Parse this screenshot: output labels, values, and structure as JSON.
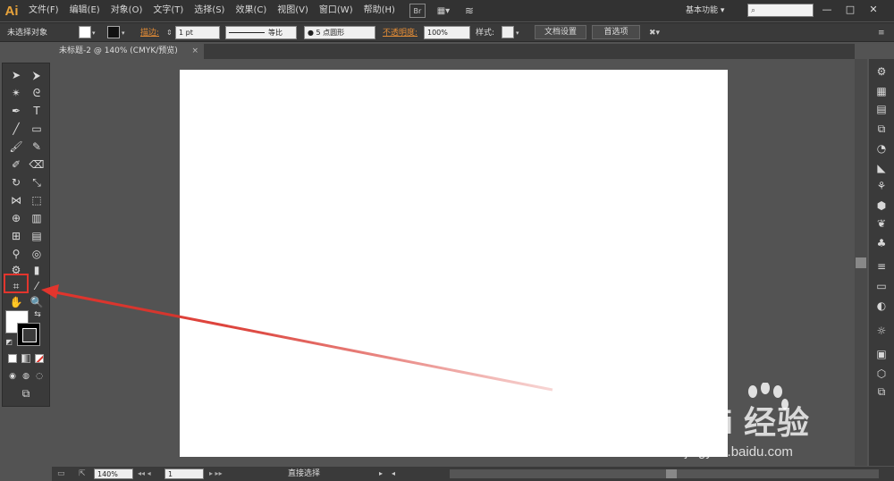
{
  "app": {
    "logo": "Ai",
    "workspace": "基本功能 ▾"
  },
  "menu": [
    "文件(F)",
    "编辑(E)",
    "对象(O)",
    "文字(T)",
    "选择(S)",
    "效果(C)",
    "视图(V)",
    "窗口(W)",
    "帮助(H)"
  ],
  "menu_icons": {
    "bridge": "Br",
    "layout": "▦▾",
    "sync": "≋"
  },
  "window_buttons": [
    "—",
    "□",
    "✕"
  ],
  "control": {
    "selection": "未选择对象",
    "stroke_label": "描边:",
    "stroke_weight": "1 pt",
    "line_profile": "等比",
    "brush": "● 5 点圆形",
    "opacity_label": "不透明度:",
    "opacity": "100%",
    "style_label": "样式:",
    "doc_setup": "文档设置",
    "preferences": "首选项"
  },
  "document_tab": {
    "title": "未标题-2 @ 140% (CMYK/预览)",
    "close": "×"
  },
  "tools": [
    {
      "name": "selection-tool",
      "glyph": "➤"
    },
    {
      "name": "direct-selection-tool",
      "glyph": "⮞"
    },
    {
      "name": "magic-wand-tool",
      "glyph": "✴"
    },
    {
      "name": "lasso-tool",
      "glyph": "ᘓ"
    },
    {
      "name": "pen-tool",
      "glyph": "✒"
    },
    {
      "name": "type-tool",
      "glyph": "T"
    },
    {
      "name": "line-segment-tool",
      "glyph": "╱"
    },
    {
      "name": "rectangle-tool",
      "glyph": "▭"
    },
    {
      "name": "paintbrush-tool",
      "glyph": "🖌"
    },
    {
      "name": "pencil-tool",
      "glyph": "✎"
    },
    {
      "name": "blob-brush-tool",
      "glyph": "✐"
    },
    {
      "name": "eraser-tool",
      "glyph": "⌫"
    },
    {
      "name": "rotate-tool",
      "glyph": "↻"
    },
    {
      "name": "scale-tool",
      "glyph": "⤡"
    },
    {
      "name": "width-tool",
      "glyph": "⋈"
    },
    {
      "name": "free-transform-tool",
      "glyph": "⬚"
    },
    {
      "name": "shape-builder-tool",
      "glyph": "⊕"
    },
    {
      "name": "perspective-grid-tool",
      "glyph": "▥"
    },
    {
      "name": "mesh-tool",
      "glyph": "⊞"
    },
    {
      "name": "gradient-tool",
      "glyph": "▤"
    },
    {
      "name": "eyedropper-tool",
      "glyph": "⚲"
    },
    {
      "name": "blend-tool",
      "glyph": "◎"
    },
    {
      "name": "symbol-sprayer-tool",
      "glyph": "⚙"
    },
    {
      "name": "column-graph-tool",
      "glyph": "▮"
    },
    {
      "name": "artboard-tool",
      "glyph": "⌗"
    },
    {
      "name": "slice-tool",
      "glyph": "⁄"
    },
    {
      "name": "hand-tool",
      "glyph": "✋"
    },
    {
      "name": "zoom-tool",
      "glyph": "🔍"
    }
  ],
  "right_panel": [
    "⚙",
    "▦",
    "▤",
    "⧉",
    "◔",
    "◣",
    "⚘",
    "⬢",
    "❦",
    "♣",
    "≡",
    "▭",
    "◐",
    "☼",
    "▣",
    "⬡",
    "⧉"
  ],
  "status": {
    "zoom": "140%",
    "artboard_num": "1",
    "current_tool": "直接选择"
  },
  "watermark": {
    "brand": "Bai 经验",
    "url": "jingyan.baidu.com"
  },
  "colors": {
    "accent_orange": "#e58d36",
    "highlight_red": "#e2352d",
    "arrow_red": "#d9332b"
  }
}
